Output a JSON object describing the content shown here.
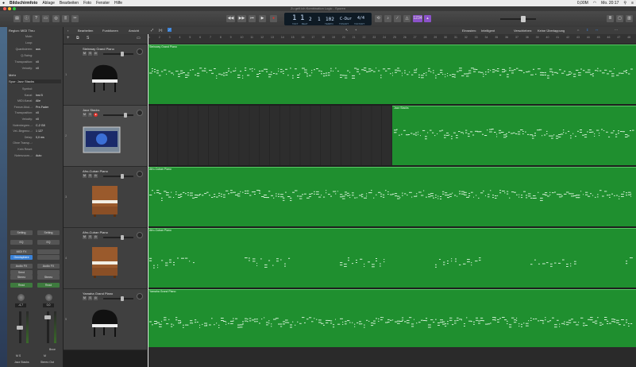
{
  "menubar": {
    "app_name": "Bildschirmfoto",
    "items": [
      "Ablage",
      "Bearbeiten",
      "Foto",
      "Fenster",
      "Hilfe"
    ],
    "status": {
      "battery": "0,00M",
      "date_time": "Mo. 20:17"
    }
  },
  "window": {
    "title": "Zu gelt ich Kombination Logic - Spuren"
  },
  "transport": {
    "position": "1 1 2 1 102",
    "bar": "1",
    "beat": "1",
    "div": "2",
    "tick": "1",
    "tempo": "102",
    "key": "C-Dur",
    "signature": "4/4",
    "lcd_labels": [
      "TAKT",
      "BEAT",
      "TEMPO",
      "TONART",
      "TAKTART"
    ]
  },
  "inspector": {
    "region_header": "Region: MIDI Thru",
    "region_rows": [
      {
        "key": "Mute:",
        "val": ""
      },
      {
        "key": "Loop:",
        "val": ""
      },
      {
        "key": "Quantisieren:",
        "val": "aus"
      },
      {
        "key": "Q-Swing:",
        "val": ""
      },
      {
        "key": "Transposition:",
        "val": "±0"
      },
      {
        "key": "Velocity:",
        "val": "±0"
      }
    ],
    "more_label": "Mehr",
    "track_header": "Spur: Jazz Stacks",
    "track_rows": [
      {
        "key": "Symbol:",
        "val": ""
      },
      {
        "key": "Kanal:",
        "val": "Inst 5"
      },
      {
        "key": "MIDI-Kanal:",
        "val": "Alle"
      },
      {
        "key": "Freeze-Mod...:",
        "val": "Pre-Fader"
      },
      {
        "key": "Transposition:",
        "val": "±0"
      },
      {
        "key": "Velocity:",
        "val": "±0"
      },
      {
        "key": "Notenbegren...:",
        "val": "C-2  G8"
      },
      {
        "key": "Vel.-Begrenz...:",
        "val": "1  127"
      },
      {
        "key": "Delay:",
        "val": "0,0 ms"
      },
      {
        "key": "Ohne Transp...:",
        "val": ""
      },
      {
        "key": "Kein Reset:",
        "val": ""
      },
      {
        "key": "Notenzuorn...:",
        "val": "Auto"
      }
    ],
    "strip_buttons_left": [
      "Setting",
      "EQ",
      "MIDI FX",
      "Omnisphere",
      "Audio FX",
      "Send",
      "Stereo",
      "Read"
    ],
    "strip_buttons_right": [
      "Setting",
      "EQ",
      "",
      "",
      "Audio FX",
      "",
      "Stereo",
      "Read"
    ],
    "meter_left": "-4,7",
    "meter_right": "0,0",
    "bounce_label": "Bnce",
    "strip_names": [
      "Jazz Stacks",
      "Stereo Out"
    ]
  },
  "tracks_toolbar": {
    "edit": "Bearbeiten",
    "functions": "Funktionen",
    "view": "Ansicht",
    "snap_label": "Einrasten:",
    "snap_value": "Intelligent",
    "drag_label": "Verschieben:",
    "drag_value": "Keine Überlappung"
  },
  "ruler": {
    "bars": [
      "1",
      "2",
      "3",
      "4",
      "5",
      "6",
      "7",
      "8",
      "9",
      "10",
      "11",
      "12",
      "13",
      "14",
      "15",
      "16",
      "17",
      "18",
      "19",
      "20",
      "21",
      "22",
      "23",
      "24",
      "25",
      "26",
      "27",
      "28",
      "29",
      "30",
      "31",
      "32",
      "33",
      "34",
      "35",
      "36",
      "37",
      "38",
      "39",
      "40",
      "41",
      "42",
      "43",
      "44",
      "45",
      "46",
      "47",
      "48"
    ]
  },
  "tracks": [
    {
      "num": "1",
      "name": "Steinway Grand Piano",
      "region": "Steinway Grand Piano",
      "instrument": "grand-piano",
      "region_start_bar": 1,
      "selected": false
    },
    {
      "num": "2",
      "name": "Jazz Stacks",
      "region": "Jazz Stacks",
      "instrument": "synth-plugin",
      "region_start_bar": 25,
      "selected": true
    },
    {
      "num": "3",
      "name": "Afro-Cuban Piano",
      "region": "Afro-Cuban Piano",
      "instrument": "upright-piano",
      "region_start_bar": 1,
      "selected": false
    },
    {
      "num": "4",
      "name": "Afro-Cuban Piano",
      "region": "Afro-Cuban Piano",
      "instrument": "upright-piano",
      "region_start_bar": 1,
      "selected": false
    },
    {
      "num": "5",
      "name": "Yamaha Grand Piano",
      "region": "Yamaha Grand Piano",
      "instrument": "grand-piano",
      "region_start_bar": 1,
      "selected": false
    }
  ],
  "colors": {
    "region_green": "#1f8f2f",
    "region_border": "#59c765",
    "record_red": "#e0302a",
    "accent_blue": "#3b82d6"
  }
}
